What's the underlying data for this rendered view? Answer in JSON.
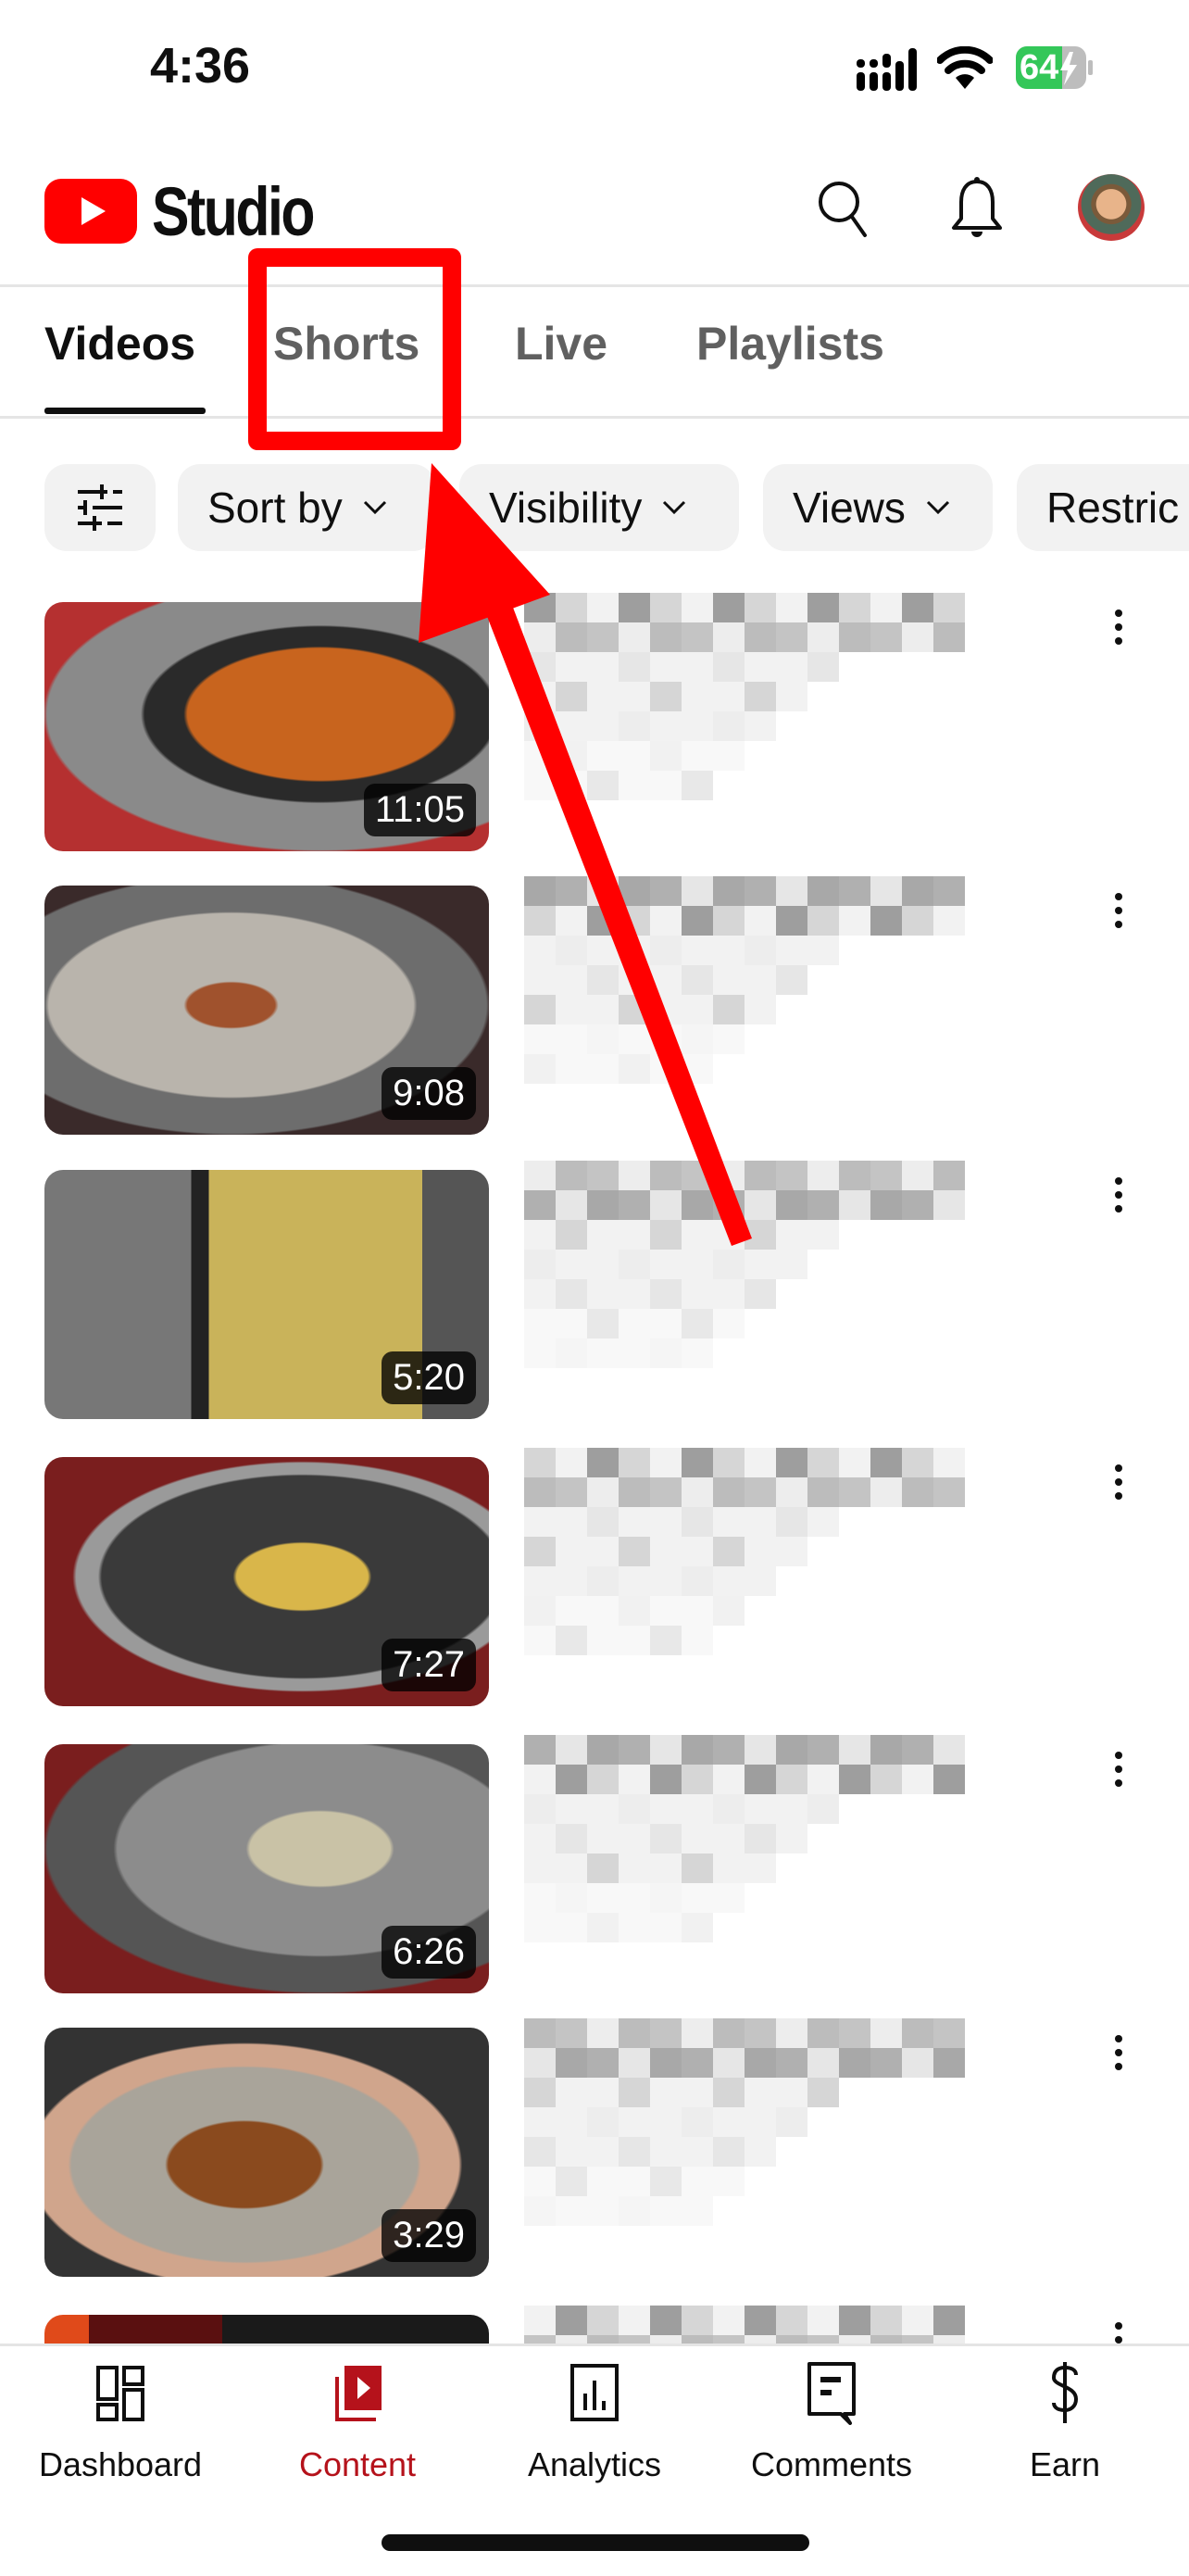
{
  "status_bar": {
    "time": "4:36",
    "battery_level": "64",
    "battery_color": "#34c759",
    "charging": true
  },
  "header": {
    "app_title": "Studio",
    "brand_color": "#ff0000",
    "icons": [
      "search-icon",
      "bell-icon",
      "avatar"
    ]
  },
  "tabs": [
    {
      "label": "Videos",
      "active": true
    },
    {
      "label": "Shorts",
      "active": false
    },
    {
      "label": "Live",
      "active": false
    },
    {
      "label": "Playlists",
      "active": false
    }
  ],
  "filters": {
    "filter_icon": "sliders-icon",
    "chips": [
      {
        "label": "Sort by"
      },
      {
        "label": "Visibility"
      },
      {
        "label": "Views"
      },
      {
        "label": "Restric"
      }
    ]
  },
  "videos": [
    {
      "duration": "11:05",
      "title": "[pixelated]"
    },
    {
      "duration": "9:08",
      "title": "[pixelated]"
    },
    {
      "duration": "5:20",
      "title": "[pixelated]"
    },
    {
      "duration": "7:27",
      "title": "[pixelated]"
    },
    {
      "duration": "6:26",
      "title": "[pixelated]"
    },
    {
      "duration": "3:29",
      "title": "[pixelated]"
    },
    {
      "duration": "",
      "title": "[pixelated]"
    }
  ],
  "bottom_nav": [
    {
      "label": "Dashboard",
      "icon": "dashboard-icon",
      "active": false
    },
    {
      "label": "Content",
      "icon": "content-icon",
      "active": true
    },
    {
      "label": "Analytics",
      "icon": "analytics-icon",
      "active": false
    },
    {
      "label": "Comments",
      "icon": "comments-icon",
      "active": false
    },
    {
      "label": "Earn",
      "icon": "dollar-icon",
      "active": false
    }
  ],
  "annotation": {
    "highlight_target": "Shorts",
    "color": "#ff0000"
  },
  "accent_color": "#b5121b"
}
